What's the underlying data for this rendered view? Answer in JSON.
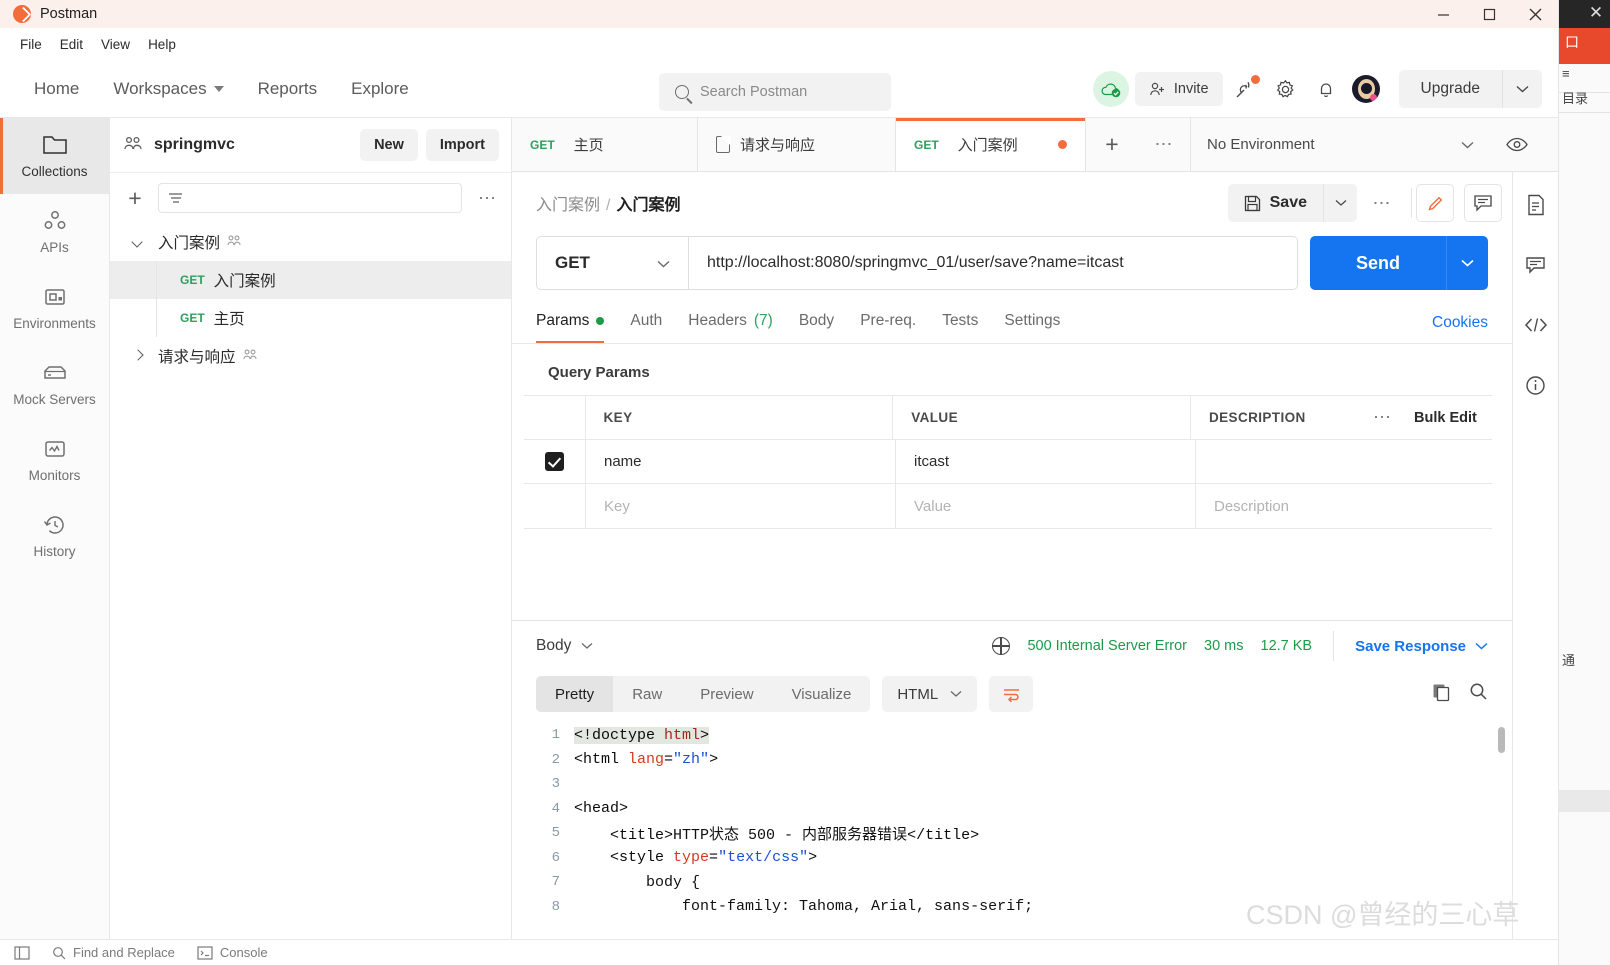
{
  "window": {
    "app_title": "Postman",
    "minimize": "—",
    "maximize": "☐",
    "close": "✕"
  },
  "menubar": {
    "items": [
      "File",
      "Edit",
      "View",
      "Help"
    ]
  },
  "header": {
    "nav": [
      {
        "label": "Home",
        "has_chevron": false
      },
      {
        "label": "Workspaces",
        "has_chevron": true
      },
      {
        "label": "Reports",
        "has_chevron": false
      },
      {
        "label": "Explore",
        "has_chevron": false
      }
    ],
    "search_placeholder": "Search Postman",
    "invite_label": "Invite",
    "upgrade_label": "Upgrade",
    "icons": [
      "cloud-sync-icon",
      "invite-icon",
      "satellite-icon",
      "gear-icon",
      "bell-icon",
      "avatar-icon"
    ]
  },
  "rail": {
    "items": [
      {
        "label": "Collections",
        "icon": "folder-icon",
        "active": true
      },
      {
        "label": "APIs",
        "icon": "apis-icon",
        "active": false
      },
      {
        "label": "Environments",
        "icon": "environments-icon",
        "active": false
      },
      {
        "label": "Mock Servers",
        "icon": "mock-server-icon",
        "active": false
      },
      {
        "label": "Monitors",
        "icon": "monitor-icon",
        "active": false
      },
      {
        "label": "History",
        "icon": "history-icon",
        "active": false
      }
    ]
  },
  "sidebar": {
    "workspace_name": "springmvc",
    "new_label": "New",
    "import_label": "Import",
    "filter_placeholder": "",
    "tree": [
      {
        "label": "入门案例",
        "type": "folder",
        "expanded": true,
        "shared": true
      },
      {
        "label": "入门案例",
        "type": "request",
        "method": "GET",
        "selected": true
      },
      {
        "label": "主页",
        "type": "request",
        "method": "GET",
        "selected": false
      },
      {
        "label": "请求与响应",
        "type": "folder",
        "expanded": false,
        "shared": true
      }
    ]
  },
  "tabbar": {
    "tabs": [
      {
        "method": "GET",
        "label": "主页",
        "active": false,
        "unsaved": false,
        "icon": ""
      },
      {
        "method": "",
        "label": "请求与响应",
        "active": false,
        "unsaved": false,
        "icon": "doc-icon"
      },
      {
        "method": "GET",
        "label": "入门案例",
        "active": true,
        "unsaved": true,
        "icon": ""
      }
    ],
    "environment": "No Environment"
  },
  "request": {
    "breadcrumb_parent": "入门案例",
    "breadcrumb_current": "入门案例",
    "save_label": "Save",
    "method": "GET",
    "url": "http://localhost:8080/springmvc_01/user/save?name=itcast",
    "send_label": "Send",
    "tabs": [
      {
        "label": "Params",
        "active": true,
        "marker": "dot"
      },
      {
        "label": "Auth",
        "active": false,
        "marker": ""
      },
      {
        "label": "Headers",
        "active": false,
        "marker": "count",
        "count": "(7)"
      },
      {
        "label": "Body",
        "active": false,
        "marker": ""
      },
      {
        "label": "Pre-req.",
        "active": false,
        "marker": ""
      },
      {
        "label": "Tests",
        "active": false,
        "marker": ""
      },
      {
        "label": "Settings",
        "active": false,
        "marker": ""
      }
    ],
    "cookies_label": "Cookies",
    "query_params_title": "Query Params",
    "params_table": {
      "headers": [
        "KEY",
        "VALUE",
        "DESCRIPTION"
      ],
      "bulk_edit_label": "Bulk Edit",
      "rows": [
        {
          "checked": true,
          "key": "name",
          "value": "itcast",
          "description": "",
          "placeholder": false
        },
        {
          "checked": false,
          "key": "Key",
          "value": "Value",
          "description": "Description",
          "placeholder": true
        }
      ]
    }
  },
  "response": {
    "body_label": "Body",
    "status": "500 Internal Server Error",
    "time": "30 ms",
    "size": "12.7 KB",
    "save_response_label": "Save Response",
    "format_tabs": [
      {
        "label": "Pretty",
        "active": true
      },
      {
        "label": "Raw",
        "active": false
      },
      {
        "label": "Preview",
        "active": false
      },
      {
        "label": "Visualize",
        "active": false
      }
    ],
    "language": "HTML",
    "code_lines": [
      {
        "n": "1",
        "segments": [
          {
            "t": "<!doctype ",
            "c": "tk-tag",
            "sel": true
          },
          {
            "t": "html",
            "c": "tk-el",
            "sel": true
          },
          {
            "t": ">",
            "c": "tk-tag",
            "sel": true
          }
        ]
      },
      {
        "n": "2",
        "segments": [
          {
            "t": "<html ",
            "c": "tk-tag"
          },
          {
            "t": "lang",
            "c": "tk-attr"
          },
          {
            "t": "=",
            "c": "tk-tag"
          },
          {
            "t": "\"zh\"",
            "c": "tk-str"
          },
          {
            "t": ">",
            "c": "tk-tag"
          }
        ]
      },
      {
        "n": "3",
        "segments": [
          {
            "t": "",
            "c": "tk-tag"
          }
        ]
      },
      {
        "n": "4",
        "segments": [
          {
            "t": "<head>",
            "c": "tk-tag"
          }
        ]
      },
      {
        "n": "5",
        "segments": [
          {
            "t": "    <title>",
            "c": "tk-tag"
          },
          {
            "t": "HTTP状态 500 - 内部服务器错误",
            "c": "tk-plain"
          },
          {
            "t": "</title>",
            "c": "tk-tag"
          }
        ]
      },
      {
        "n": "6",
        "segments": [
          {
            "t": "    <style ",
            "c": "tk-tag"
          },
          {
            "t": "type",
            "c": "tk-attr"
          },
          {
            "t": "=",
            "c": "tk-tag"
          },
          {
            "t": "\"text/css\"",
            "c": "tk-str"
          },
          {
            "t": ">",
            "c": "tk-tag"
          }
        ]
      },
      {
        "n": "7",
        "segments": [
          {
            "t": "        body {",
            "c": "tk-plain"
          }
        ]
      },
      {
        "n": "8",
        "segments": [
          {
            "t": "            font-family: Tahoma, Arial, sans-serif;",
            "c": "tk-plain"
          }
        ]
      }
    ]
  },
  "right_rail": {
    "items": [
      "documentation-icon",
      "comment-icon",
      "code-icon",
      "info-icon"
    ]
  },
  "bottombar": {
    "items": [
      "Find and Replace",
      "Console"
    ]
  },
  "watermark": "CSDN @曾经的三心草",
  "colors": {
    "accent": "#f26c3d",
    "send_blue": "#1574ef",
    "green": "#1a9b47",
    "link_blue": "#1574ef"
  }
}
